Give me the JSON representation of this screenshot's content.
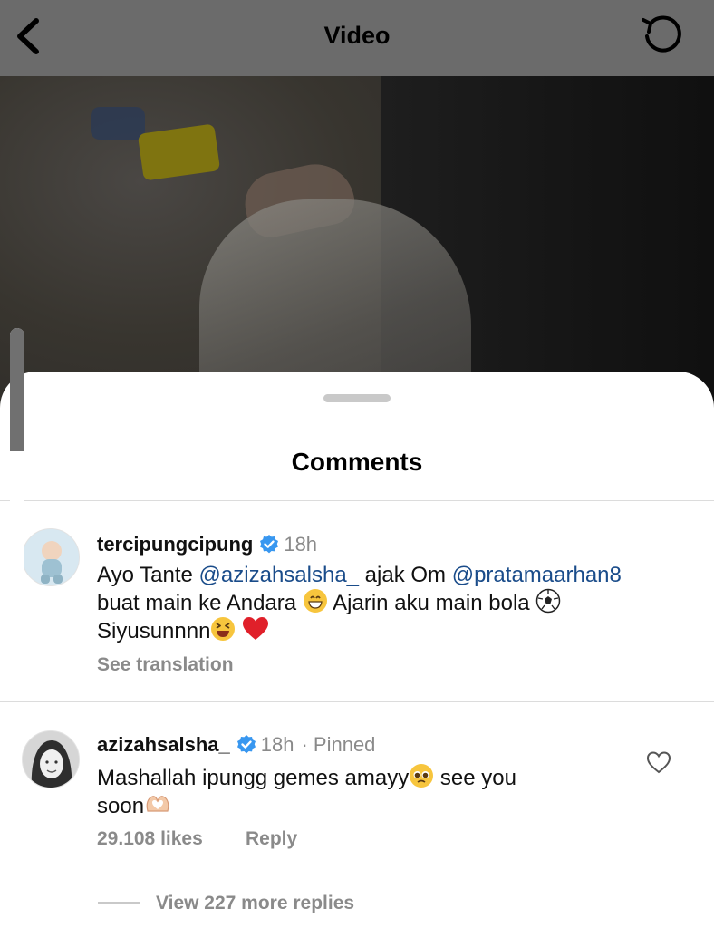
{
  "header": {
    "title": "Video"
  },
  "sheet": {
    "title": "Comments"
  },
  "comments": [
    {
      "username": "tercipungcipung",
      "verified": true,
      "time": "18h",
      "mention_1": "@azizahsalsha_",
      "mention_2": "@pratamaarhan8",
      "text_before_mention_1": "Ayo Tante ",
      "text_between": " ajak Om ",
      "text_line2": "buat main ke Andara ",
      "text_line2b": " Ajarin aku main bola",
      "text_line3": "Siyusunnnn",
      "emojis": [
        "grinning-face",
        "soccer-ball",
        "laughing-face",
        "red-heart"
      ],
      "see_translation": "See translation"
    },
    {
      "username": "azizahsalsha_",
      "verified": true,
      "time": "18h",
      "pinned": "· Pinned",
      "text_line1a": "Mashallah ipungg gemes amayy",
      "text_line1b": " see you",
      "text_line2": "soon",
      "emojis": [
        "pleading-face",
        "heart-hands"
      ],
      "likes": "29.108 likes",
      "reply": "Reply",
      "view_replies": "View 227 more replies"
    }
  ],
  "colors": {
    "accent_mention": "#1a4c8a",
    "verified_blue": "#3897f0",
    "muted_text": "#8a8a8a",
    "topbar_bg": "#6b6b6b"
  },
  "icons": [
    "back-arrow-icon",
    "replay-icon",
    "verified-icon",
    "heart-icon"
  ]
}
